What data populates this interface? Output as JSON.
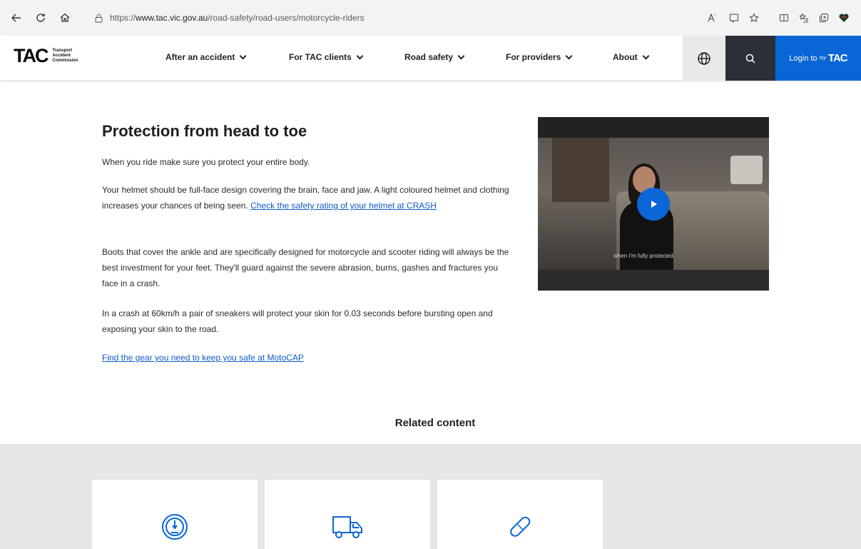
{
  "browser": {
    "url_prefix": "https://",
    "url_host": "www.tac.vic.gov.au",
    "url_path": "/road-safety/road-users/motorcycle-riders"
  },
  "header": {
    "logo_text": "TAC",
    "logo_sub": [
      "Transport",
      "Accident",
      "Commission"
    ],
    "nav": [
      {
        "label": "After an accident"
      },
      {
        "label": "For TAC clients"
      },
      {
        "label": "Road safety"
      },
      {
        "label": "For providers"
      },
      {
        "label": "About"
      }
    ],
    "login_label": "Login to",
    "login_my": "my",
    "login_logo": "TAC"
  },
  "main": {
    "heading": "Protection from head to toe",
    "p1": "When you ride make sure you protect your entire body.",
    "p2_text": "Your helmet should be full-face design covering the brain, face and jaw. A light coloured helmet and clothing increases your chances of being seen.",
    "p2_link": "Check the safety rating of your helmet at CRASH",
    "p3": "Boots that cover the ankle  and are specifically designed for motorcycle and scooter riding will always be the best investment for your feet. They'll guard against the severe abrasion, burns, gashes and fractures you  face in a crash.",
    "p4": "In a crash at 60km/h a pair of sneakers will protect your skin for 0.03 seconds before bursting open and exposing your skin to the road.",
    "link_motocap": "Find the gear you need to keep you safe at MotoCAP"
  },
  "video": {
    "caption": "when I'm fully protected."
  },
  "related": {
    "title": "Related content",
    "cards": [
      {
        "icon": "speedometer-icon"
      },
      {
        "icon": "truck-icon"
      },
      {
        "icon": "bandage-icon"
      }
    ]
  },
  "colors": {
    "brand_blue": "#0a66d6",
    "link_blue": "#0b5cc7",
    "dark_nav": "#2a2f38"
  }
}
